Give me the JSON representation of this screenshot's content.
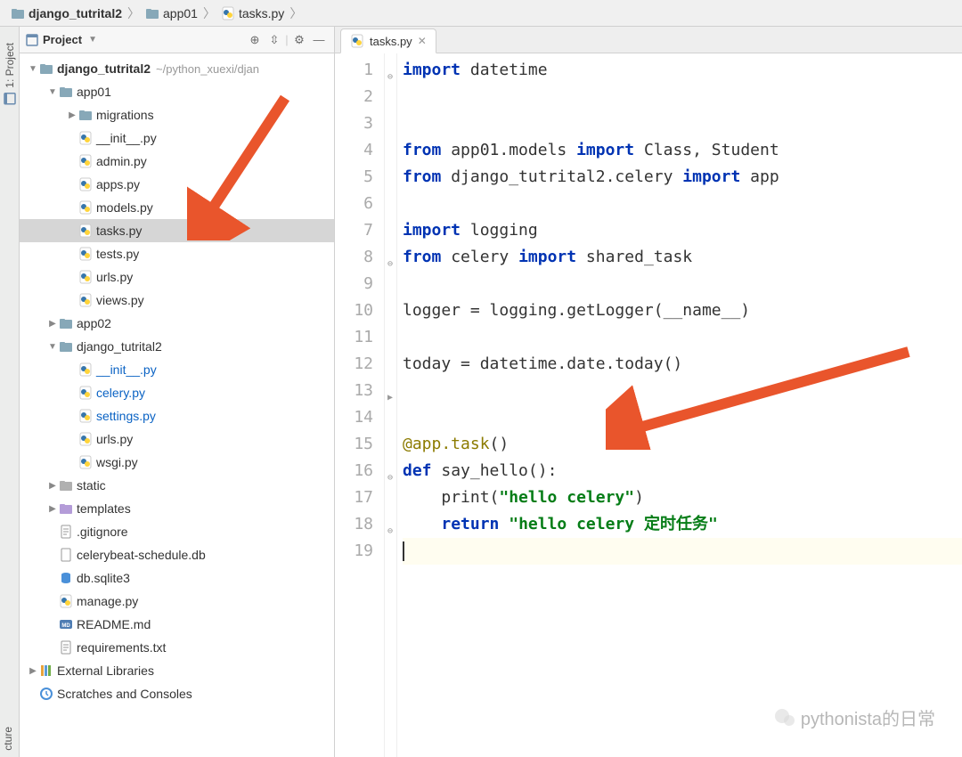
{
  "breadcrumb": {
    "items": [
      {
        "icon": "folder",
        "label": "django_tutrital2"
      },
      {
        "icon": "folder",
        "label": "app01"
      },
      {
        "icon": "py",
        "label": "tasks.py"
      }
    ]
  },
  "side_tabs": {
    "project": "1: Project",
    "structure": "cture"
  },
  "sidebar": {
    "header": {
      "title_icon": "project-pane-icon",
      "title": "Project",
      "buttons": [
        "target",
        "collapse",
        "divider",
        "gear",
        "hide"
      ]
    },
    "tree": [
      {
        "indent": 0,
        "chev": "▼",
        "icon": "folder",
        "label": "django_tutrital2",
        "bold": true,
        "tail": "~/python_xuexi/djan"
      },
      {
        "indent": 1,
        "chev": "▼",
        "icon": "folder",
        "label": "app01"
      },
      {
        "indent": 2,
        "chev": "▶",
        "icon": "folder",
        "label": "migrations"
      },
      {
        "indent": 2,
        "chev": "",
        "icon": "py",
        "label": "__init__.py"
      },
      {
        "indent": 2,
        "chev": "",
        "icon": "py",
        "label": "admin.py"
      },
      {
        "indent": 2,
        "chev": "",
        "icon": "py",
        "label": "apps.py"
      },
      {
        "indent": 2,
        "chev": "",
        "icon": "py",
        "label": "models.py"
      },
      {
        "indent": 2,
        "chev": "",
        "icon": "py",
        "label": "tasks.py",
        "selected": true
      },
      {
        "indent": 2,
        "chev": "",
        "icon": "py",
        "label": "tests.py"
      },
      {
        "indent": 2,
        "chev": "",
        "icon": "py",
        "label": "urls.py"
      },
      {
        "indent": 2,
        "chev": "",
        "icon": "py",
        "label": "views.py"
      },
      {
        "indent": 1,
        "chev": "▶",
        "icon": "folder",
        "label": "app02"
      },
      {
        "indent": 1,
        "chev": "▼",
        "icon": "folder",
        "label": "django_tutrital2"
      },
      {
        "indent": 2,
        "chev": "",
        "icon": "py",
        "label": "__init__.py",
        "blue": true
      },
      {
        "indent": 2,
        "chev": "",
        "icon": "py",
        "label": "celery.py",
        "blue": true
      },
      {
        "indent": 2,
        "chev": "",
        "icon": "py",
        "label": "settings.py",
        "blue": true
      },
      {
        "indent": 2,
        "chev": "",
        "icon": "py",
        "label": "urls.py"
      },
      {
        "indent": 2,
        "chev": "",
        "icon": "py",
        "label": "wsgi.py"
      },
      {
        "indent": 1,
        "chev": "▶",
        "icon": "folder-grey",
        "label": "static"
      },
      {
        "indent": 1,
        "chev": "▶",
        "icon": "folder-purple",
        "label": "templates"
      },
      {
        "indent": 1,
        "chev": "",
        "icon": "txt",
        "label": ".gitignore"
      },
      {
        "indent": 1,
        "chev": "",
        "icon": "file",
        "label": "celerybeat-schedule.db"
      },
      {
        "indent": 1,
        "chev": "",
        "icon": "db",
        "label": "db.sqlite3"
      },
      {
        "indent": 1,
        "chev": "",
        "icon": "py",
        "label": "manage.py"
      },
      {
        "indent": 1,
        "chev": "",
        "icon": "md",
        "label": "README.md"
      },
      {
        "indent": 1,
        "chev": "",
        "icon": "txt",
        "label": "requirements.txt"
      },
      {
        "indent": 0,
        "chev": "▶",
        "icon": "libs",
        "label": "External Libraries"
      },
      {
        "indent": 0,
        "chev": "",
        "icon": "scratch",
        "label": "Scratches and Consoles"
      }
    ]
  },
  "tabs": [
    {
      "icon": "py",
      "label": "tasks.py"
    }
  ],
  "code": {
    "lines": [
      {
        "n": 1,
        "tokens": [
          [
            "kw",
            "import"
          ],
          [
            "",
            " datetime"
          ]
        ]
      },
      {
        "n": 2,
        "tokens": []
      },
      {
        "n": 3,
        "tokens": []
      },
      {
        "n": 4,
        "tokens": [
          [
            "kw",
            "from"
          ],
          [
            "",
            " app01.models "
          ],
          [
            "kw",
            "import"
          ],
          [
            "",
            " Class, Student"
          ]
        ]
      },
      {
        "n": 5,
        "tokens": [
          [
            "kw",
            "from"
          ],
          [
            "",
            " django_tutrital2.celery "
          ],
          [
            "kw",
            "import"
          ],
          [
            "",
            " app"
          ]
        ]
      },
      {
        "n": 6,
        "tokens": []
      },
      {
        "n": 7,
        "tokens": [
          [
            "kw",
            "import"
          ],
          [
            "",
            " logging"
          ]
        ]
      },
      {
        "n": 8,
        "tokens": [
          [
            "kw",
            "from"
          ],
          [
            "",
            " celery "
          ],
          [
            "kw",
            "import"
          ],
          [
            "",
            " shared_task"
          ]
        ]
      },
      {
        "n": 9,
        "tokens": []
      },
      {
        "n": 10,
        "tokens": [
          [
            "",
            "logger = logging.getLogger(__name__)"
          ]
        ]
      },
      {
        "n": 11,
        "tokens": []
      },
      {
        "n": 12,
        "tokens": [
          [
            "",
            "today = datetime.date.today()"
          ]
        ]
      },
      {
        "n": 13,
        "tokens": []
      },
      {
        "n": 14,
        "tokens": []
      },
      {
        "n": 15,
        "tokens": [
          [
            "dec",
            "@app.task"
          ],
          [
            "",
            "()"
          ]
        ]
      },
      {
        "n": 16,
        "tokens": [
          [
            "kw",
            "def"
          ],
          [
            "",
            " "
          ],
          [
            "fn",
            "say_hello"
          ],
          [
            "",
            "():"
          ]
        ]
      },
      {
        "n": 17,
        "tokens": [
          [
            "",
            "    print("
          ],
          [
            "str",
            "\"hello celery\""
          ],
          [
            "",
            ")"
          ]
        ]
      },
      {
        "n": 18,
        "tokens": [
          [
            "",
            "    "
          ],
          [
            "kw",
            "return"
          ],
          [
            "",
            " "
          ],
          [
            "str",
            "\"hello celery 定时任务\""
          ]
        ]
      },
      {
        "n": 19,
        "tokens": [],
        "current": true
      }
    ]
  },
  "watermark": "pythonista的日常",
  "colors": {
    "arrow": "#e9552c"
  }
}
